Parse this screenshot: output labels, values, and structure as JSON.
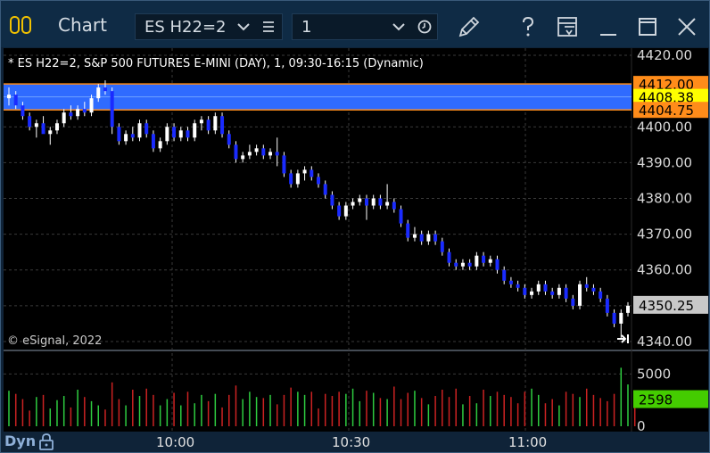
{
  "window": {
    "title": "Chart",
    "symbol": "ES H22=2",
    "interval": "1"
  },
  "chart_data": {
    "type": "candlestick",
    "title": "* ES H22=2, S&P 500 FUTURES E-MINI (DAY), 1, 09:30-16:15 (Dynamic)",
    "watermark": "© eSignal, 2022",
    "y_ticks": [
      "4420.00",
      "4410.00",
      "4400.00",
      "4390.00",
      "4380.00",
      "4370.00",
      "4360.00",
      "4350.00",
      "4340.00"
    ],
    "ylim": [
      4338,
      4422
    ],
    "x_ticks": [
      "10:00",
      "10:30",
      "11:00"
    ],
    "last_price": "4350.25",
    "price_flags": [
      {
        "label": "4412.00",
        "color": "#ff8c1a"
      },
      {
        "label": "4408.38",
        "color": "#ffff00"
      },
      {
        "label": "4404.75",
        "color": "#ff8c1a"
      }
    ],
    "band": {
      "upper": 4412.0,
      "mid": 4408.38,
      "lower": 4404.75
    },
    "candles_ohlc": [
      [
        4408,
        4411,
        4406,
        4409
      ],
      [
        4409,
        4410,
        4405,
        4406
      ],
      [
        4406,
        4407,
        4402,
        4403
      ],
      [
        4403,
        4404,
        4399,
        4400
      ],
      [
        4400,
        4402,
        4397,
        4401
      ],
      [
        4401,
        4403,
        4399,
        4398
      ],
      [
        4398,
        4400,
        4395,
        4399
      ],
      [
        4399,
        4402,
        4398,
        4401
      ],
      [
        4401,
        4405,
        4400,
        4404
      ],
      [
        4404,
        4406,
        4402,
        4403
      ],
      [
        4403,
        4406,
        4402,
        4405
      ],
      [
        4405,
        4407,
        4403,
        4404
      ],
      [
        4404,
        4409,
        4403,
        4408
      ],
      [
        4408,
        4412,
        4407,
        4411
      ],
      [
        4411,
        4413,
        4409,
        4410
      ],
      [
        4410,
        4411,
        4398,
        4400
      ],
      [
        4400,
        4401,
        4395,
        4396
      ],
      [
        4396,
        4399,
        4395,
        4398
      ],
      [
        4398,
        4400,
        4396,
        4397
      ],
      [
        4397,
        4402,
        4396,
        4401
      ],
      [
        4401,
        4402,
        4397,
        4398
      ],
      [
        4398,
        4399,
        4393,
        4394
      ],
      [
        4394,
        4397,
        4393,
        4396
      ],
      [
        4396,
        4401,
        4395,
        4400
      ],
      [
        4400,
        4401,
        4396,
        4397
      ],
      [
        4397,
        4400,
        4396,
        4399
      ],
      [
        4399,
        4400,
        4396,
        4397
      ],
      [
        4397,
        4402,
        4396,
        4401
      ],
      [
        4401,
        4403,
        4399,
        4402
      ],
      [
        4402,
        4403,
        4398,
        4399
      ],
      [
        4399,
        4404,
        4398,
        4403
      ],
      [
        4403,
        4404,
        4397,
        4398
      ],
      [
        4398,
        4399,
        4394,
        4395
      ],
      [
        4395,
        4396,
        4390,
        4391
      ],
      [
        4391,
        4393,
        4390,
        4392
      ],
      [
        4392,
        4395,
        4391,
        4393
      ],
      [
        4393,
        4395,
        4392,
        4394
      ],
      [
        4394,
        4395,
        4391,
        4392
      ],
      [
        4392,
        4394,
        4391,
        4393
      ],
      [
        4393,
        4397,
        4389,
        4392
      ],
      [
        4392,
        4393,
        4386,
        4387
      ],
      [
        4387,
        4388,
        4383,
        4384
      ],
      [
        4384,
        4388,
        4383,
        4387
      ],
      [
        4387,
        4389,
        4385,
        4388
      ],
      [
        4388,
        4389,
        4385,
        4386
      ],
      [
        4386,
        4387,
        4383,
        4384
      ],
      [
        4384,
        4385,
        4380,
        4381
      ],
      [
        4381,
        4382,
        4377,
        4378
      ],
      [
        4378,
        4379,
        4374,
        4375
      ],
      [
        4375,
        4379,
        4374,
        4378
      ],
      [
        4378,
        4380,
        4377,
        4379
      ],
      [
        4379,
        4381,
        4378,
        4380
      ],
      [
        4380,
        4381,
        4374,
        4378
      ],
      [
        4378,
        4381,
        4377,
        4380
      ],
      [
        4380,
        4381,
        4377,
        4378
      ],
      [
        4378,
        4384,
        4377,
        4379
      ],
      [
        4379,
        4380,
        4376,
        4377
      ],
      [
        4377,
        4378,
        4372,
        4373
      ],
      [
        4373,
        4374,
        4368,
        4369
      ],
      [
        4369,
        4372,
        4368,
        4370
      ],
      [
        4370,
        4371,
        4367,
        4368
      ],
      [
        4368,
        4371,
        4367,
        4370
      ],
      [
        4370,
        4371,
        4367,
        4368
      ],
      [
        4368,
        4369,
        4364,
        4365
      ],
      [
        4365,
        4366,
        4361,
        4362
      ],
      [
        4362,
        4363,
        4360,
        4361
      ],
      [
        4361,
        4363,
        4360,
        4362
      ],
      [
        4362,
        4363,
        4360,
        4361
      ],
      [
        4361,
        4365,
        4360,
        4364
      ],
      [
        4364,
        4365,
        4361,
        4362
      ],
      [
        4362,
        4364,
        4361,
        4363
      ],
      [
        4363,
        4364,
        4359,
        4360
      ],
      [
        4360,
        4361,
        4356,
        4357
      ],
      [
        4357,
        4358,
        4355,
        4356
      ],
      [
        4356,
        4357,
        4354,
        4355
      ],
      [
        4355,
        4356,
        4352,
        4353
      ],
      [
        4353,
        4355,
        4352,
        4354
      ],
      [
        4354,
        4357,
        4353,
        4356
      ],
      [
        4356,
        4357,
        4353,
        4354
      ],
      [
        4354,
        4355,
        4352,
        4353
      ],
      [
        4353,
        4356,
        4352,
        4355
      ],
      [
        4355,
        4356,
        4351,
        4352
      ],
      [
        4352,
        4353,
        4349,
        4350
      ],
      [
        4350,
        4357,
        4349,
        4356
      ],
      [
        4356,
        4358,
        4354,
        4355
      ],
      [
        4355,
        4356,
        4353,
        4354
      ],
      [
        4354,
        4355,
        4351,
        4352
      ],
      [
        4352,
        4353,
        4347,
        4348
      ],
      [
        4348,
        4349,
        4344,
        4345
      ],
      [
        4345,
        4349,
        4341,
        4348
      ],
      [
        4348,
        4351,
        4347,
        4350
      ]
    ],
    "volume_scale": {
      "max": 7000,
      "tick": "5000",
      "zero": "0"
    },
    "volume_last": "2598",
    "volumes": [
      3400,
      3100,
      2600,
      1500,
      2800,
      3000,
      1700,
      2500,
      2900,
      1800,
      3500,
      2800,
      2400,
      2000,
      1600,
      4200,
      2600,
      2000,
      3500,
      2900,
      3600,
      3000,
      2000,
      2600,
      3200,
      2000,
      3300,
      2200,
      3000,
      2400,
      3100,
      1800,
      3000,
      3900,
      2600,
      3300,
      2800,
      2700,
      3000,
      2100,
      3000,
      3700,
      3300,
      3000,
      3300,
      1700,
      3100,
      2900,
      3300,
      3100,
      3600,
      2400,
      3400,
      3200,
      2700,
      2600,
      3800,
      2600,
      3200,
      3400,
      2700,
      2100,
      2900,
      3500,
      2800,
      3600,
      2100,
      2900,
      2200,
      3500,
      2900,
      3300,
      3000,
      2800,
      2200,
      3300,
      3600,
      3000,
      2200,
      2600,
      2000,
      3300,
      3100,
      2800,
      3600,
      3000,
      2700,
      2400,
      3100,
      5600,
      4000,
      2600
    ]
  },
  "bottom": {
    "mode": "Dyn",
    "times": [
      "10:00",
      "10:30",
      "11:00"
    ]
  }
}
